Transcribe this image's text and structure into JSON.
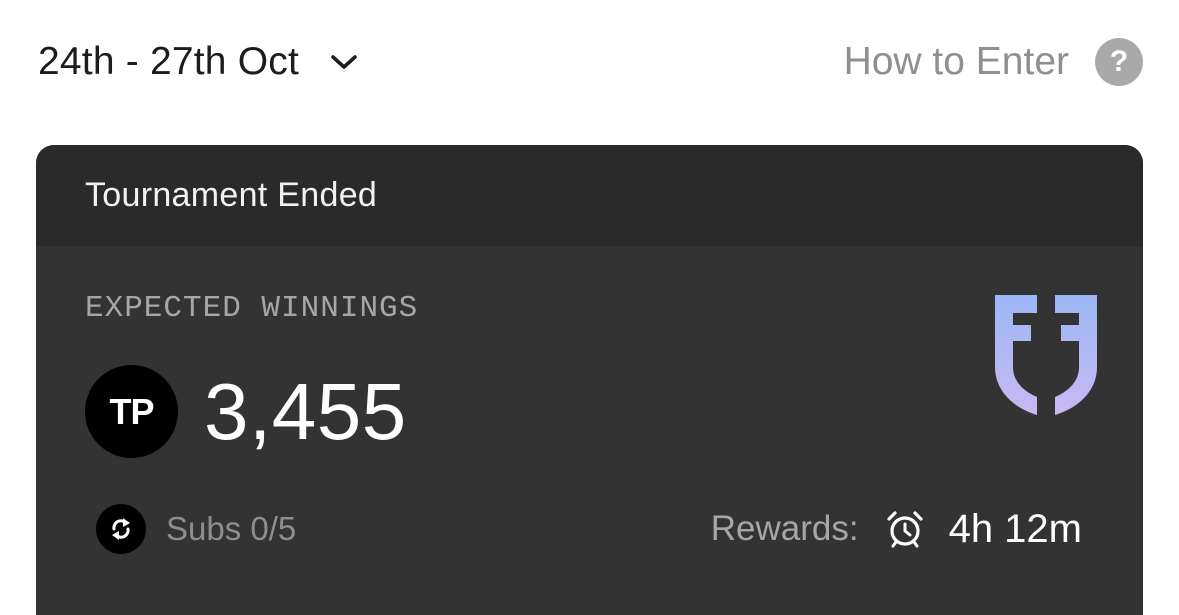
{
  "header": {
    "date_range": "24th - 27th Oct",
    "date_dropdown_icon": "chevron-down-icon",
    "how_to_enter": "How to Enter",
    "help_icon_glyph": "?"
  },
  "card": {
    "status": "Tournament Ended",
    "winnings_label": "EXPECTED WINNINGS",
    "currency_badge": "TP",
    "amount": "3,455",
    "logo_icon": "shield-logo-icon",
    "subs_label": "Subs 0/5",
    "subs_icon": "swap-arrows-icon",
    "rewards_label": "Rewards:",
    "rewards_icon": "alarm-clock-icon",
    "rewards_time": "4h 12m"
  },
  "colors": {
    "card_background": "#333333",
    "card_header_background": "#2a2a2a",
    "muted_text": "#8e8e93",
    "help_circle": "#a9a9a9",
    "logo_gradient_top": "#9bb8f5",
    "logo_gradient_bottom": "#c9b8f2"
  }
}
